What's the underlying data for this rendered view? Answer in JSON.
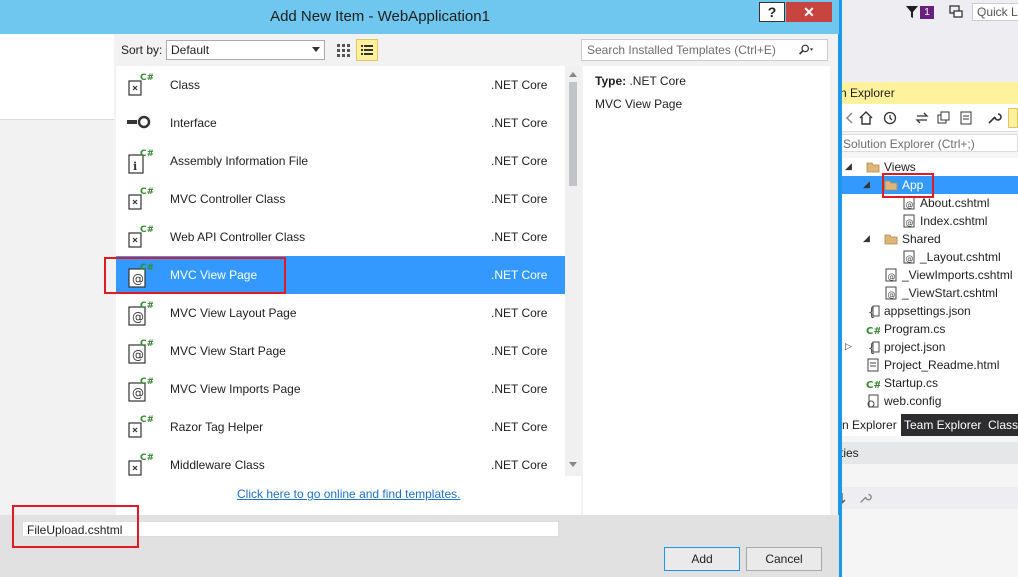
{
  "dialog": {
    "title": "Add New Item - WebApplication1",
    "help_label": "?",
    "close_label": "✕",
    "sort_label": "Sort by:",
    "sort_value": "Default",
    "search_placeholder": "Search Installed Templates (Ctrl+E)",
    "items": [
      {
        "name": "Class",
        "lang": ".NET Core",
        "icon": "csharp-class-icon"
      },
      {
        "name": "Interface",
        "lang": ".NET Core",
        "icon": "interface-icon"
      },
      {
        "name": "Assembly Information File",
        "lang": ".NET Core",
        "icon": "assembly-info-icon"
      },
      {
        "name": "MVC Controller Class",
        "lang": ".NET Core",
        "icon": "csharp-class-icon"
      },
      {
        "name": "Web API Controller Class",
        "lang": ".NET Core",
        "icon": "csharp-class-icon"
      },
      {
        "name": "MVC View Page",
        "lang": ".NET Core",
        "icon": "razor-page-icon",
        "selected": true
      },
      {
        "name": "MVC View Layout Page",
        "lang": ".NET Core",
        "icon": "razor-page-icon"
      },
      {
        "name": "MVC View Start Page",
        "lang": ".NET Core",
        "icon": "razor-page-icon"
      },
      {
        "name": "MVC View Imports Page",
        "lang": ".NET Core",
        "icon": "razor-page-icon"
      },
      {
        "name": "Razor Tag Helper",
        "lang": ".NET Core",
        "icon": "csharp-class-icon"
      },
      {
        "name": "Middleware Class",
        "lang": ".NET Core",
        "icon": "csharp-class-icon"
      }
    ],
    "online_link": "Click here to go online and find templates.",
    "detail": {
      "type_label": "Type:",
      "type_value": ".NET Core",
      "description": "MVC View Page"
    },
    "name_value": "FileUpload.cshtml",
    "add_label": "Add",
    "cancel_label": "Cancel"
  },
  "vs": {
    "filter_badge": "1",
    "quick_launch": "Quick L",
    "solution_explorer_title": "n Explorer",
    "se_search_placeholder": "Solution Explorer (Ctrl+;)",
    "tree": [
      {
        "label": "Views",
        "depth": 2,
        "expander": "◢",
        "icon": "folder-icon"
      },
      {
        "label": "App",
        "depth": 3,
        "expander": "◢",
        "icon": "folder-icon",
        "selected": true
      },
      {
        "label": "About.cshtml",
        "depth": 4,
        "expander": "",
        "icon": "razor-file-icon"
      },
      {
        "label": "Index.cshtml",
        "depth": 4,
        "expander": "",
        "icon": "razor-file-icon"
      },
      {
        "label": "Shared",
        "depth": 3,
        "expander": "◢",
        "icon": "folder-icon"
      },
      {
        "label": "_Layout.cshtml",
        "depth": 4,
        "expander": "",
        "icon": "razor-file-icon"
      },
      {
        "label": "_ViewImports.cshtml",
        "depth": 3,
        "expander": "",
        "icon": "razor-file-icon"
      },
      {
        "label": "_ViewStart.cshtml",
        "depth": 3,
        "expander": "",
        "icon": "razor-file-icon"
      },
      {
        "label": "appsettings.json",
        "depth": 2,
        "expander": "",
        "icon": "json-file-icon"
      },
      {
        "label": "Program.cs",
        "depth": 2,
        "expander": "",
        "icon": "csharp-file-icon"
      },
      {
        "label": "project.json",
        "depth": 2,
        "expander": "▷",
        "icon": "json-file-icon"
      },
      {
        "label": "Project_Readme.html",
        "depth": 2,
        "expander": "",
        "icon": "html-file-icon"
      },
      {
        "label": "Startup.cs",
        "depth": 2,
        "expander": "",
        "icon": "csharp-file-icon"
      },
      {
        "label": "web.config",
        "depth": 2,
        "expander": "",
        "icon": "config-file-icon"
      }
    ],
    "tabs": [
      {
        "label": "n Explorer",
        "active": true
      },
      {
        "label": "Team Explorer",
        "active": false
      },
      {
        "label": "Class",
        "active": false
      }
    ],
    "properties_title": "ties"
  },
  "colors": {
    "titlebar": "#6fc7ef",
    "selection": "#3399ff",
    "annotation_red": "#e01b24",
    "link": "#1e6fc7"
  }
}
